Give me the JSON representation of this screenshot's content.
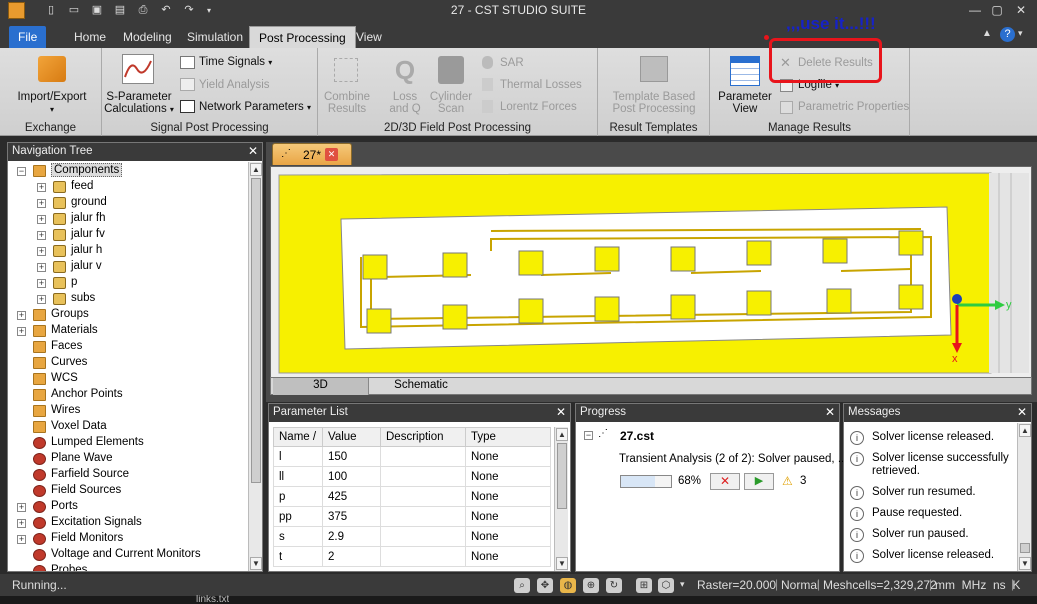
{
  "window": {
    "title": "27 - CST STUDIO SUITE"
  },
  "ribbon_tabs": [
    "File",
    "Home",
    "Modeling",
    "Simulation",
    "Post Processing",
    "View"
  ],
  "annotation": ",,,use it...!!!",
  "groups": {
    "exchange": {
      "label": "Exchange",
      "import_export": "Import/Export"
    },
    "signal": {
      "label": "Signal Post Processing",
      "sparam_line1": "S-Parameter",
      "sparam_line2": "Calculations",
      "time_signals": "Time Signals",
      "yield_analysis": "Yield Analysis",
      "network_parameters": "Network Parameters"
    },
    "field": {
      "label": "2D/3D Field Post Processing",
      "combine_l1": "Combine",
      "combine_l2": "Results",
      "loss_l1": "Loss",
      "loss_l2": "and Q",
      "cyl_l1": "Cylinder",
      "cyl_l2": "Scan",
      "sar": "SAR",
      "thermal": "Thermal Losses",
      "lorentz": "Lorentz Forces"
    },
    "templates": {
      "label": "Result Templates",
      "tpl_l1": "Template Based",
      "tpl_l2": "Post Processing"
    },
    "manage": {
      "label": "Manage Results",
      "pv_l1": "Parameter",
      "pv_l2": "View",
      "delete_results": "Delete Results",
      "logfile": "Logfile",
      "parametric_properties": "Parametric Properties"
    }
  },
  "nav": {
    "title": "Navigation Tree",
    "items": [
      {
        "label": "Components",
        "depth": 0,
        "expander": "-",
        "icon": "folder",
        "selected": true
      },
      {
        "label": "feed",
        "depth": 1,
        "expander": "+",
        "icon": "component"
      },
      {
        "label": "ground",
        "depth": 1,
        "expander": "+",
        "icon": "component"
      },
      {
        "label": "jalur fh",
        "depth": 1,
        "expander": "+",
        "icon": "component"
      },
      {
        "label": "jalur fv",
        "depth": 1,
        "expander": "+",
        "icon": "component"
      },
      {
        "label": "jalur h",
        "depth": 1,
        "expander": "+",
        "icon": "component"
      },
      {
        "label": "jalur v",
        "depth": 1,
        "expander": "+",
        "icon": "component"
      },
      {
        "label": "p",
        "depth": 1,
        "expander": "+",
        "icon": "component"
      },
      {
        "label": "subs",
        "depth": 1,
        "expander": "+",
        "icon": "component"
      },
      {
        "label": "Groups",
        "depth": 0,
        "expander": "+",
        "icon": "folder"
      },
      {
        "label": "Materials",
        "depth": 0,
        "expander": "+",
        "icon": "folder"
      },
      {
        "label": "Faces",
        "depth": 0,
        "expander": "",
        "icon": "folder"
      },
      {
        "label": "Curves",
        "depth": 0,
        "expander": "",
        "icon": "folder"
      },
      {
        "label": "WCS",
        "depth": 0,
        "expander": "",
        "icon": "folder"
      },
      {
        "label": "Anchor Points",
        "depth": 0,
        "expander": "",
        "icon": "folder"
      },
      {
        "label": "Wires",
        "depth": 0,
        "expander": "",
        "icon": "folder"
      },
      {
        "label": "Voxel Data",
        "depth": 0,
        "expander": "",
        "icon": "folder"
      },
      {
        "label": "Lumped Elements",
        "depth": 0,
        "expander": "",
        "icon": "field"
      },
      {
        "label": "Plane Wave",
        "depth": 0,
        "expander": "",
        "icon": "field"
      },
      {
        "label": "Farfield Source",
        "depth": 0,
        "expander": "",
        "icon": "field"
      },
      {
        "label": "Field Sources",
        "depth": 0,
        "expander": "",
        "icon": "field"
      },
      {
        "label": "Ports",
        "depth": 0,
        "expander": "+",
        "icon": "field"
      },
      {
        "label": "Excitation Signals",
        "depth": 0,
        "expander": "+",
        "icon": "field"
      },
      {
        "label": "Field Monitors",
        "depth": 0,
        "expander": "+",
        "icon": "field"
      },
      {
        "label": "Voltage and Current Monitors",
        "depth": 0,
        "expander": "",
        "icon": "field"
      },
      {
        "label": "Probes",
        "depth": 0,
        "expander": "",
        "icon": "field"
      }
    ]
  },
  "document": {
    "tab": "27*",
    "view_tabs": [
      "3D",
      "Schematic"
    ],
    "axis_y": "y",
    "axis_x": "x"
  },
  "params": {
    "title": "Parameter List",
    "columns": [
      "Name /",
      "Value",
      "Description",
      "Type"
    ],
    "rows": [
      {
        "name": "l",
        "value": "150",
        "description": "",
        "type": "None"
      },
      {
        "name": "ll",
        "value": "100",
        "description": "",
        "type": "None"
      },
      {
        "name": "p",
        "value": "425",
        "description": "",
        "type": "None"
      },
      {
        "name": "pp",
        "value": "375",
        "description": "",
        "type": "None"
      },
      {
        "name": "s",
        "value": "2.9",
        "description": "",
        "type": "None"
      },
      {
        "name": "t",
        "value": "2",
        "description": "",
        "type": "None"
      }
    ]
  },
  "progress": {
    "title": "Progress",
    "file": "27.cst",
    "task": "Transient Analysis (2 of 2): Solver paused, ...",
    "percent": 68,
    "percent_text": "68%",
    "warnings": "3"
  },
  "messages": {
    "title": "Messages",
    "items": [
      [
        "Solver license released."
      ],
      [
        "Solver license successfully",
        "retrieved."
      ],
      [
        "Solver run resumed."
      ],
      [
        "Pause requested."
      ],
      [
        "Solver run paused."
      ],
      [
        "Solver license released."
      ]
    ]
  },
  "status": {
    "left": "Running...",
    "raster": "Raster=20.000",
    "mode": "Normal",
    "meshcells": "Meshcells=2,329,272",
    "units": "mm  MHz  ns  K",
    "below": "links.txt"
  },
  "colors": {
    "accent_file": "#2a6fcf",
    "highlight_red": "#e8141b",
    "annotation_blue": "#1622c8",
    "substrate_yellow": "#f7f000"
  }
}
